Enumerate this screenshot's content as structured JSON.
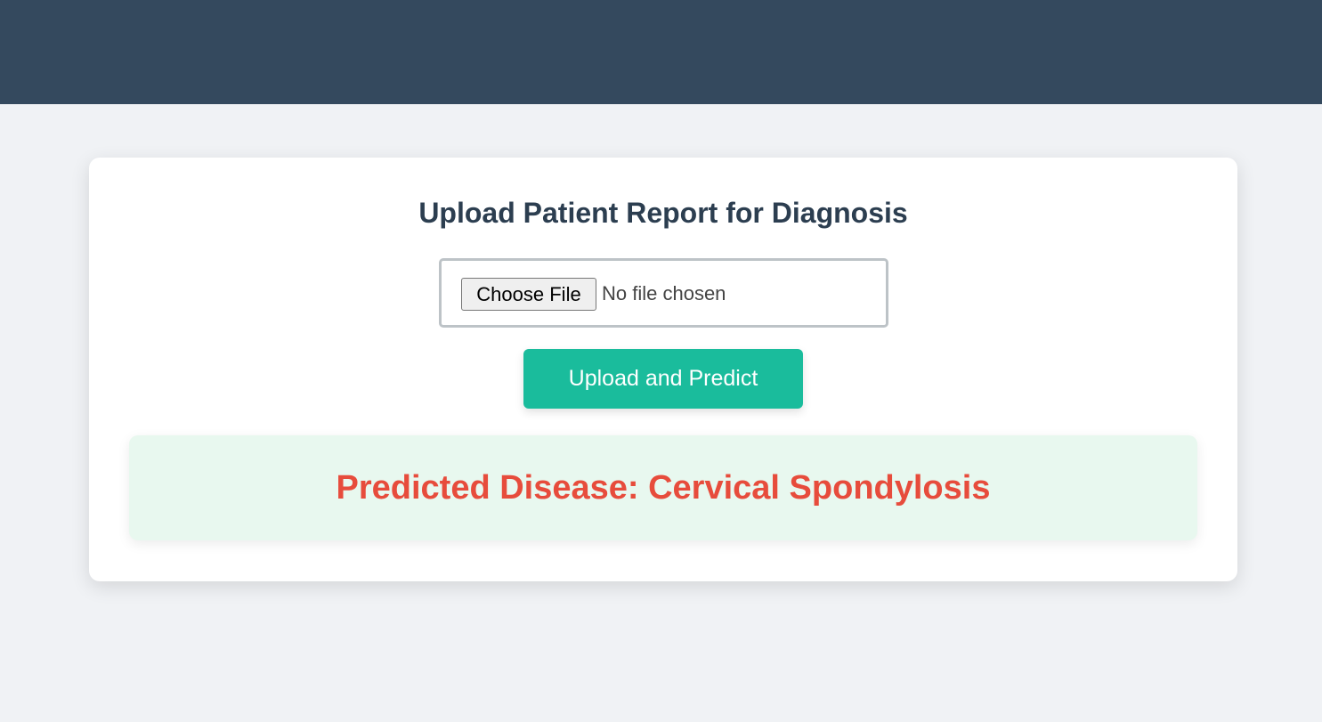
{
  "colors": {
    "header_bar": "#34495e",
    "page_background": "#f0f2f5",
    "card_background": "#ffffff",
    "title_text": "#2c3e50",
    "primary_button": "#1abc9c",
    "result_background": "#e8f8ef",
    "result_text": "#e74c3c"
  },
  "main": {
    "title": "Upload Patient Report for Diagnosis",
    "file_input": {
      "button_label": "Choose File",
      "status": "No file chosen"
    },
    "submit_label": "Upload and Predict",
    "result": {
      "text": "Predicted Disease: Cervical Spondylosis"
    }
  }
}
